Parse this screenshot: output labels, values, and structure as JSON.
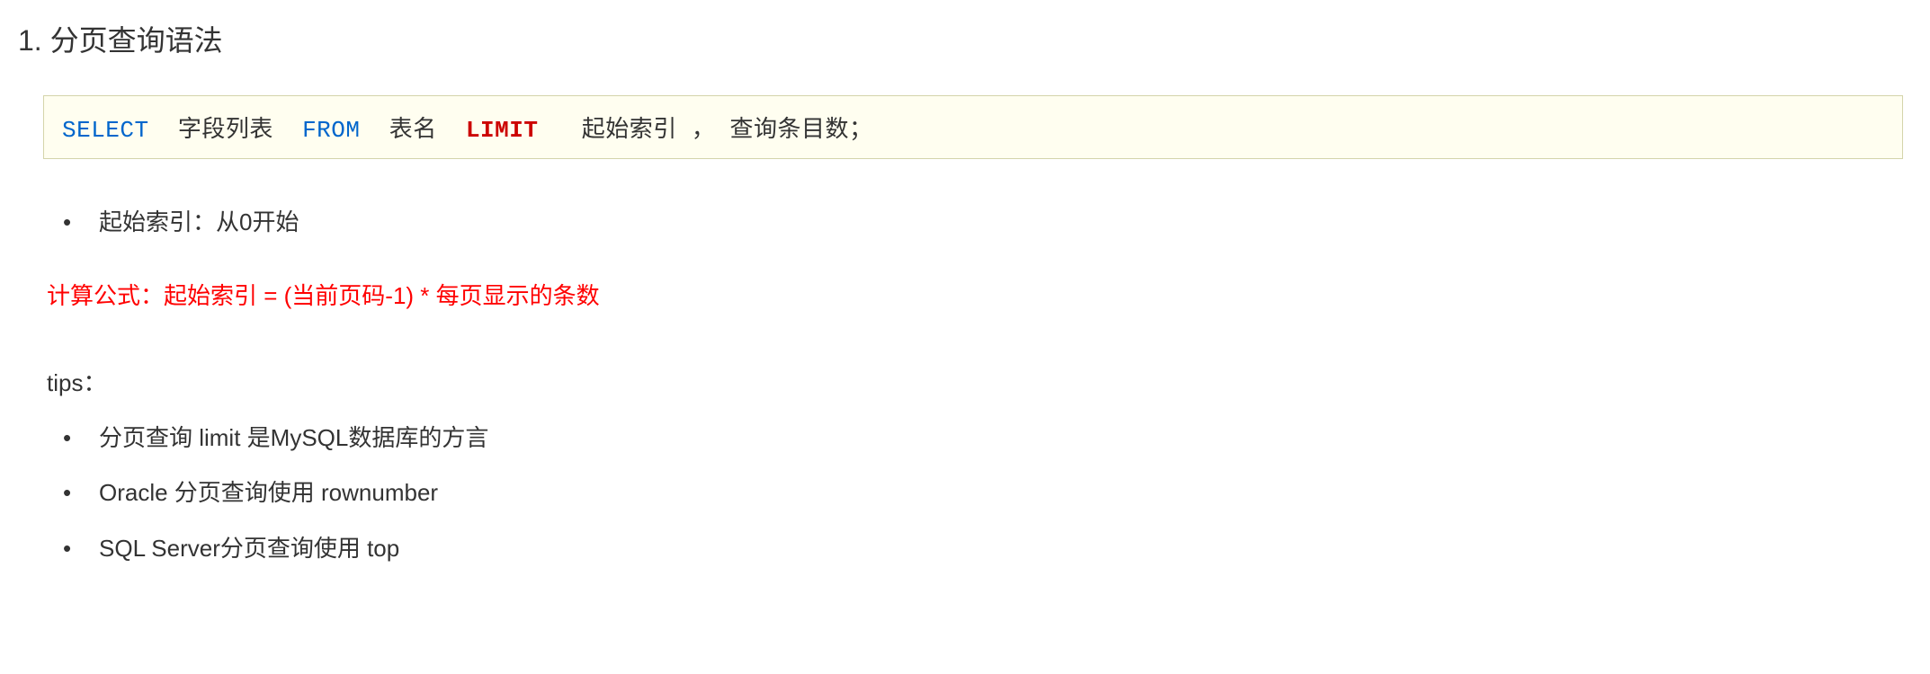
{
  "heading": "1. 分页查询语法",
  "code": {
    "select": "SELECT",
    "fields": "字段列表",
    "from": "FROM",
    "table": "表名",
    "limit": "LIMIT",
    "start": "起始索引",
    "comma": "，",
    "count": "查询条目数；"
  },
  "bullet1": "起始索引：从0开始",
  "formula": "计算公式：起始索引 = (当前页码-1)  *  每页显示的条数",
  "tips_label": "tips：",
  "tips": [
    "分页查询 limit 是MySQL数据库的方言",
    "Oracle 分页查询使用 rownumber",
    "SQL Server分页查询使用 top"
  ]
}
